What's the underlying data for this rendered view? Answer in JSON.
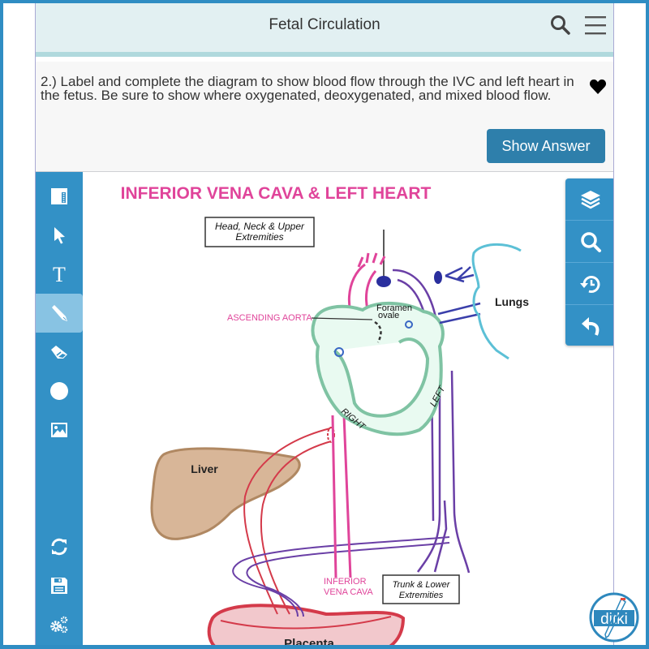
{
  "header": {
    "title": "Fetal Circulation",
    "search_icon": "search-icon",
    "menu_icon": "hamburger-menu-icon"
  },
  "question": {
    "text": "2.)  Label and complete the diagram to show blood flow through the IVC and left heart in the fetus. Be sure to show where oxygenated, deoxygenated, and mixed blood flow.",
    "favorite_icon": "heart-icon",
    "show_answer_label": "Show Answer"
  },
  "left_toolbar": {
    "tools": [
      {
        "name": "panel-toggle",
        "icon": "sidebar-layout-icon",
        "active": false
      },
      {
        "name": "select",
        "icon": "cursor-arrow-icon",
        "active": false
      },
      {
        "name": "text",
        "icon": "text-t-icon",
        "active": false
      },
      {
        "name": "pencil",
        "icon": "pencil-icon",
        "active": true
      },
      {
        "name": "eraser",
        "icon": "eraser-icon",
        "active": false
      },
      {
        "name": "shape",
        "icon": "circle-icon",
        "active": false
      },
      {
        "name": "image",
        "icon": "image-icon",
        "active": false
      },
      {
        "name": "refresh",
        "icon": "refresh-icon",
        "active": false
      },
      {
        "name": "save",
        "icon": "floppy-disk-icon",
        "active": false
      },
      {
        "name": "settings",
        "icon": "gears-icon",
        "active": false
      }
    ]
  },
  "right_toolbar": {
    "tools": [
      {
        "name": "layers",
        "icon": "layers-icon"
      },
      {
        "name": "zoom",
        "icon": "magnifier-icon"
      },
      {
        "name": "history",
        "icon": "history-icon"
      },
      {
        "name": "undo",
        "icon": "undo-icon"
      }
    ]
  },
  "diagram": {
    "title": "INFERIOR VENA CAVA & LEFT HEART",
    "labels": {
      "head_neck_line1": "Head, Neck & Upper",
      "head_neck_line2": "Extremities",
      "ascending_aorta": "ASCENDING AORTA",
      "foramen_line1": "Foramen",
      "foramen_line2": "ovale",
      "lungs": "Lungs",
      "right": "RIGHT",
      "left": "LEFT",
      "liver": "Liver",
      "ivc_line1": "INFERIOR",
      "ivc_line2": "VENA CAVA",
      "trunk_line1": "Trunk & Lower",
      "trunk_line2": "Extremities",
      "placenta": "Placenta"
    },
    "colors": {
      "title": "#e0449a",
      "aorta": "#e0449a",
      "heart": "#7fc3a3",
      "heart_fill": "#e9faf1",
      "deoxygenated": "#6a3fa6",
      "pulmonary": "#3a3faa",
      "lungs": "#5cc0d6",
      "umbilical": "#d43a4a",
      "liver": "#d8b698",
      "placenta": "#f2c8cc"
    }
  },
  "logo": {
    "text": "ditki"
  },
  "theme": {
    "frame": "#2f8dc3",
    "toolbar": "#3391c6",
    "toolbar_active": "#88c3e3",
    "button": "#2e7fab",
    "header_bg": "#e2f0f2"
  }
}
